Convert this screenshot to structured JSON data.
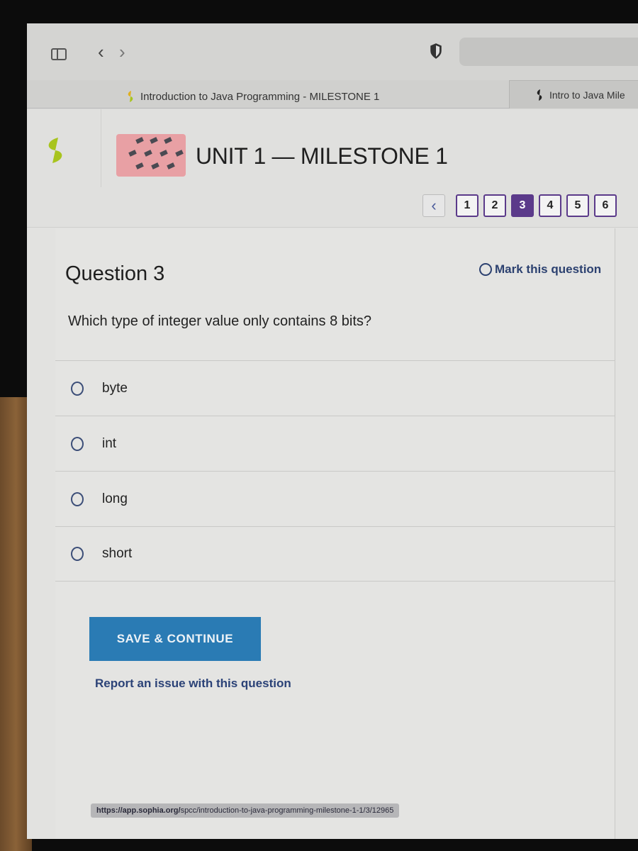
{
  "browser": {
    "sidebar_toggle": "sidebar-toggle",
    "back": "‹",
    "forward": "›",
    "tabs": [
      {
        "label": "Introduction to Java Programming - MILESTONE 1",
        "active": true
      },
      {
        "label": "Intro to Java Mile",
        "active": false
      }
    ]
  },
  "header": {
    "unit_title": "UNIT 1 — MILESTONE 1"
  },
  "pager": {
    "prev_label": "‹",
    "pages": [
      "1",
      "2",
      "3",
      "4",
      "5",
      "6"
    ],
    "current": "3"
  },
  "question": {
    "title": "Question 3",
    "mark_label": "Mark this question",
    "text": "Which type of integer value only contains 8 bits?",
    "answers": [
      "byte",
      "int",
      "long",
      "short"
    ]
  },
  "actions": {
    "save_label": "SAVE & CONTINUE",
    "report_label": "Report an issue with this question"
  },
  "status_url": {
    "host": "https://app.sophia.org/",
    "path": "spcc/introduction-to-java-programming-milestone-1-1/3/12965"
  },
  "colors": {
    "accent_purple": "#5b3a8a",
    "button_blue": "#2a7bb4",
    "link_navy": "#2b4277",
    "brand_green": "#a8c41e"
  }
}
